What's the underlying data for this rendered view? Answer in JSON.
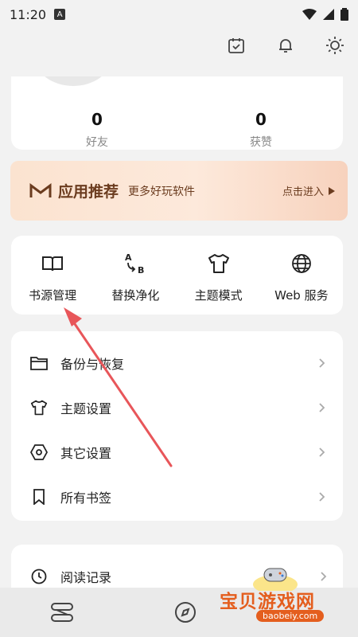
{
  "status_bar": {
    "time": "11:20",
    "badge": "A"
  },
  "profile": {
    "friends_value": "0",
    "friends_label": "好友",
    "likes_value": "0",
    "likes_label": "获赞"
  },
  "promo": {
    "title": "应用推荐",
    "subtitle": "更多好玩软件",
    "action": "点击进入"
  },
  "quick_actions": [
    {
      "label": "书源管理",
      "icon": "book-icon"
    },
    {
      "label": "替换净化",
      "icon": "replace-icon"
    },
    {
      "label": "主题模式",
      "icon": "tshirt-icon"
    },
    {
      "label": "Web 服务",
      "icon": "globe-icon"
    }
  ],
  "settings": [
    {
      "label": "备份与恢复",
      "icon": "folder-icon"
    },
    {
      "label": "主题设置",
      "icon": "tshirt-icon"
    },
    {
      "label": "其它设置",
      "icon": "hexagon-settings-icon"
    },
    {
      "label": "所有书签",
      "icon": "bookmark-icon"
    }
  ],
  "history": {
    "label": "阅读记录",
    "icon": "clock-icon"
  },
  "watermark": {
    "text": "宝贝游戏网",
    "url": "baobeiy.com"
  },
  "colors": {
    "accent": "#6b3c1f",
    "annotation": "#e8565a",
    "watermark": "#e45e1e"
  }
}
